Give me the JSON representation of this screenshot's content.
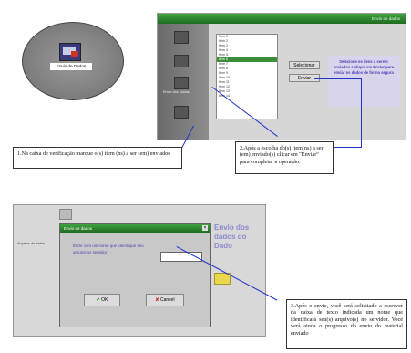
{
  "top_screen": {
    "title_bar": "Envio de dados",
    "desktop_icon_label": "Envio de Dados",
    "sidebar_label": "Envio dos Dados",
    "list_items": [
      "Item 1",
      "Item 2",
      "Item 3",
      "Item 4",
      "Item 5",
      "Item 6",
      "Item 7",
      "Item 8",
      "Item 9",
      "Item 10",
      "Item 11",
      "Item 12",
      "Item 13",
      "Item 14"
    ],
    "select_button": "Selecionar",
    "send_button": "Enviar",
    "info_text": "Selecione os itens a serem enviados e clique em Enviar para enviar os dados de forma segura"
  },
  "bottom_screen": {
    "dialog_title": "Envio de dados",
    "dialog_prompt": "Entre com um nome que identifique seu arquivo no servidor",
    "ok_button": "OK",
    "cancel_button": "Cancel",
    "side_heading": "Envio dos dados do Dado",
    "left_text": "Arquivos de dados"
  },
  "callouts": {
    "one": "1.Na caixa de verificação  marque o(s) item (ns) a ser (em)  enviados",
    "two": "2.Após a escolha do(s) item(ns) a ser (em) enviado(s) clicar em \"Enviar\" para completar a operação.",
    "three": "3.Após o envio, você será solicitado a escrever na caixa de texto indicada um nome que identificará seu(s) arquivo(s) no servidor. Você verá ainda o progresso do envio do material enviado"
  },
  "colors": {
    "title_green": "#2e8b2e",
    "panel_gray": "#c8c8c8",
    "info_blue_bg": "#d8d4ec",
    "info_blue_text": "#4a3fb8",
    "connector": "#2233cc"
  }
}
